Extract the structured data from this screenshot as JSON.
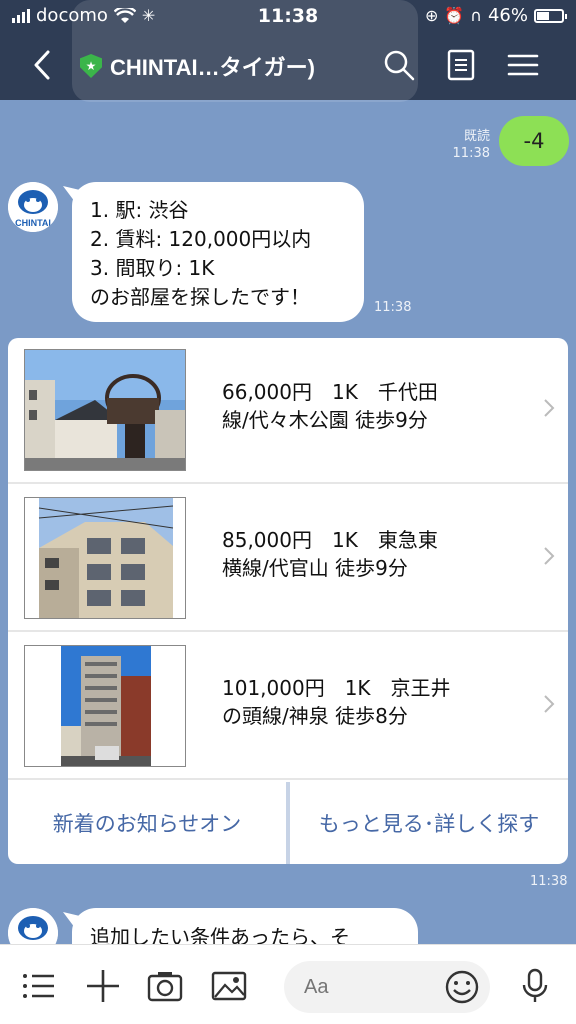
{
  "status_bar": {
    "carrier": "docomo",
    "time": "11:38",
    "battery": "46%",
    "battery_level": 0.46
  },
  "header": {
    "title": "CHINTAI…タイガー)"
  },
  "conversation": {
    "my_message": {
      "text": "-4",
      "read_label": "既読",
      "time": "11:38"
    },
    "bot_message": {
      "lines": [
        "1. 駅: 渋谷",
        "2. 賃料: 120,000円以内",
        "3. 間取り: 1K",
        "のお部屋を探したです！"
      ],
      "time": "11:38"
    },
    "avatar_text": "CHINTAI",
    "listings": [
      {
        "line1": "66,000円　1K　千代田",
        "line2": "線/代々木公園 徒歩9分"
      },
      {
        "line1": "85,000円　1K　東急東",
        "line2": "横線/代官山 徒歩9分"
      },
      {
        "line1": "101,000円　1K　京王井",
        "line2": "の頭線/神泉 徒歩8分"
      }
    ],
    "actions": {
      "notify": "新着のお知らせオン",
      "more": "もっと見る･詳しく探す"
    },
    "carousel_time": "11:38",
    "bot_message2": "追加したい条件あったら、そ"
  },
  "input_bar": {
    "placeholder": "Aa"
  },
  "colors": {
    "chat_bg": "#7b9ac6",
    "header_bg": "#2f3d55",
    "my_bubble": "#8de055",
    "action_text": "#4668a6"
  }
}
